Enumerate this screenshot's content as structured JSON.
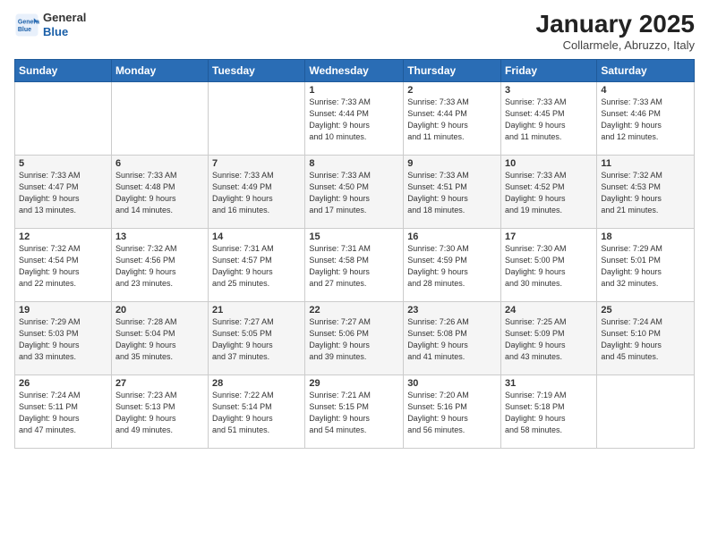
{
  "header": {
    "logo_line1": "General",
    "logo_line2": "Blue",
    "month": "January 2025",
    "location": "Collarmele, Abruzzo, Italy"
  },
  "weekdays": [
    "Sunday",
    "Monday",
    "Tuesday",
    "Wednesday",
    "Thursday",
    "Friday",
    "Saturday"
  ],
  "weeks": [
    [
      {
        "day": "",
        "info": ""
      },
      {
        "day": "",
        "info": ""
      },
      {
        "day": "",
        "info": ""
      },
      {
        "day": "1",
        "info": "Sunrise: 7:33 AM\nSunset: 4:44 PM\nDaylight: 9 hours\nand 10 minutes."
      },
      {
        "day": "2",
        "info": "Sunrise: 7:33 AM\nSunset: 4:44 PM\nDaylight: 9 hours\nand 11 minutes."
      },
      {
        "day": "3",
        "info": "Sunrise: 7:33 AM\nSunset: 4:45 PM\nDaylight: 9 hours\nand 11 minutes."
      },
      {
        "day": "4",
        "info": "Sunrise: 7:33 AM\nSunset: 4:46 PM\nDaylight: 9 hours\nand 12 minutes."
      }
    ],
    [
      {
        "day": "5",
        "info": "Sunrise: 7:33 AM\nSunset: 4:47 PM\nDaylight: 9 hours\nand 13 minutes."
      },
      {
        "day": "6",
        "info": "Sunrise: 7:33 AM\nSunset: 4:48 PM\nDaylight: 9 hours\nand 14 minutes."
      },
      {
        "day": "7",
        "info": "Sunrise: 7:33 AM\nSunset: 4:49 PM\nDaylight: 9 hours\nand 16 minutes."
      },
      {
        "day": "8",
        "info": "Sunrise: 7:33 AM\nSunset: 4:50 PM\nDaylight: 9 hours\nand 17 minutes."
      },
      {
        "day": "9",
        "info": "Sunrise: 7:33 AM\nSunset: 4:51 PM\nDaylight: 9 hours\nand 18 minutes."
      },
      {
        "day": "10",
        "info": "Sunrise: 7:33 AM\nSunset: 4:52 PM\nDaylight: 9 hours\nand 19 minutes."
      },
      {
        "day": "11",
        "info": "Sunrise: 7:32 AM\nSunset: 4:53 PM\nDaylight: 9 hours\nand 21 minutes."
      }
    ],
    [
      {
        "day": "12",
        "info": "Sunrise: 7:32 AM\nSunset: 4:54 PM\nDaylight: 9 hours\nand 22 minutes."
      },
      {
        "day": "13",
        "info": "Sunrise: 7:32 AM\nSunset: 4:56 PM\nDaylight: 9 hours\nand 23 minutes."
      },
      {
        "day": "14",
        "info": "Sunrise: 7:31 AM\nSunset: 4:57 PM\nDaylight: 9 hours\nand 25 minutes."
      },
      {
        "day": "15",
        "info": "Sunrise: 7:31 AM\nSunset: 4:58 PM\nDaylight: 9 hours\nand 27 minutes."
      },
      {
        "day": "16",
        "info": "Sunrise: 7:30 AM\nSunset: 4:59 PM\nDaylight: 9 hours\nand 28 minutes."
      },
      {
        "day": "17",
        "info": "Sunrise: 7:30 AM\nSunset: 5:00 PM\nDaylight: 9 hours\nand 30 minutes."
      },
      {
        "day": "18",
        "info": "Sunrise: 7:29 AM\nSunset: 5:01 PM\nDaylight: 9 hours\nand 32 minutes."
      }
    ],
    [
      {
        "day": "19",
        "info": "Sunrise: 7:29 AM\nSunset: 5:03 PM\nDaylight: 9 hours\nand 33 minutes."
      },
      {
        "day": "20",
        "info": "Sunrise: 7:28 AM\nSunset: 5:04 PM\nDaylight: 9 hours\nand 35 minutes."
      },
      {
        "day": "21",
        "info": "Sunrise: 7:27 AM\nSunset: 5:05 PM\nDaylight: 9 hours\nand 37 minutes."
      },
      {
        "day": "22",
        "info": "Sunrise: 7:27 AM\nSunset: 5:06 PM\nDaylight: 9 hours\nand 39 minutes."
      },
      {
        "day": "23",
        "info": "Sunrise: 7:26 AM\nSunset: 5:08 PM\nDaylight: 9 hours\nand 41 minutes."
      },
      {
        "day": "24",
        "info": "Sunrise: 7:25 AM\nSunset: 5:09 PM\nDaylight: 9 hours\nand 43 minutes."
      },
      {
        "day": "25",
        "info": "Sunrise: 7:24 AM\nSunset: 5:10 PM\nDaylight: 9 hours\nand 45 minutes."
      }
    ],
    [
      {
        "day": "26",
        "info": "Sunrise: 7:24 AM\nSunset: 5:11 PM\nDaylight: 9 hours\nand 47 minutes."
      },
      {
        "day": "27",
        "info": "Sunrise: 7:23 AM\nSunset: 5:13 PM\nDaylight: 9 hours\nand 49 minutes."
      },
      {
        "day": "28",
        "info": "Sunrise: 7:22 AM\nSunset: 5:14 PM\nDaylight: 9 hours\nand 51 minutes."
      },
      {
        "day": "29",
        "info": "Sunrise: 7:21 AM\nSunset: 5:15 PM\nDaylight: 9 hours\nand 54 minutes."
      },
      {
        "day": "30",
        "info": "Sunrise: 7:20 AM\nSunset: 5:16 PM\nDaylight: 9 hours\nand 56 minutes."
      },
      {
        "day": "31",
        "info": "Sunrise: 7:19 AM\nSunset: 5:18 PM\nDaylight: 9 hours\nand 58 minutes."
      },
      {
        "day": "",
        "info": ""
      }
    ]
  ]
}
